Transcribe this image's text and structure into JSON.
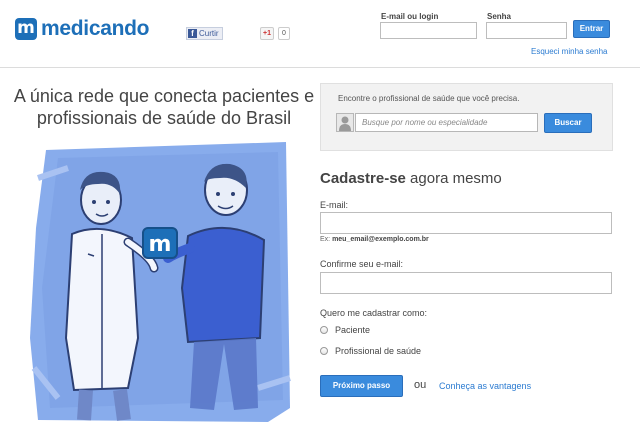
{
  "header": {
    "logo_mark": "m",
    "logo_text": "medicando",
    "facebook_label": "Curtir",
    "facebook_icon": "f",
    "gplus_label": "+1",
    "gplus_count": "0",
    "email_label": "E-mail ou login",
    "password_label": "Senha",
    "login_button": "Entrar",
    "forgot_link": "Esqueci minha senha"
  },
  "hero": {
    "headline": "A única rede que conecta pacientes e profissionais de saúde do Brasil",
    "illustration_badge": "m"
  },
  "search": {
    "title": "Encontre o profissional de saúde que você precisa.",
    "placeholder": "Busque por nome ou especialidade",
    "button": "Buscar"
  },
  "signup": {
    "title_bold": "Cadastre-se",
    "title_rest": " agora mesmo",
    "email_label": "E-mail:",
    "email_hint_prefix": "Ex: ",
    "email_hint_example": "meu_email@exemplo.com.br",
    "confirm_label": "Confirme seu e-mail:",
    "role_label": "Quero me cadastrar como:",
    "roles": [
      "Paciente",
      "Profissional de saúde"
    ],
    "next_button": "Próximo passo",
    "or_text": "ou",
    "benefits_link": "Conheça as vantagens"
  },
  "colors": {
    "brand": "#1d6fb8",
    "button": "#3a8bdd",
    "link": "#2b7bd1",
    "illustration_bg": "#7fa6e8"
  },
  "icons": [
    "facebook-icon",
    "gplus-icon",
    "user-avatar-icon",
    "radio-icon"
  ]
}
